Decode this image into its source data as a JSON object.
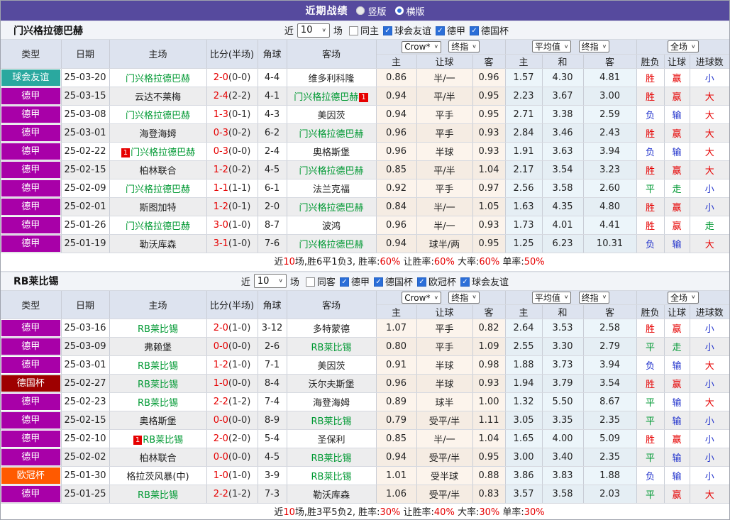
{
  "topbar": {
    "title": "近期战绩",
    "radios": [
      {
        "label": "竖版",
        "selected": false
      },
      {
        "label": "横版",
        "selected": true
      }
    ]
  },
  "filter_labels": {
    "near": "近",
    "games": "场"
  },
  "columns": {
    "type": "类型",
    "date": "日期",
    "home": "主场",
    "score": "比分(半场)",
    "corner": "角球",
    "away": "客场",
    "dropdown_groups": [
      [
        "Crow*",
        "终指"
      ],
      [
        "平均值",
        "终指"
      ],
      [
        "全场"
      ]
    ],
    "sub": [
      "主",
      "让球",
      "客",
      "主",
      "和",
      "客",
      "胜负",
      "让球",
      "进球数"
    ]
  },
  "colors": {
    "topbar_purple": "#564a9e",
    "checkbox_blue": "#2b6ed8",
    "team_green": "#009933",
    "score_red": "#e60000",
    "result_text": {
      "胜": "#e60000",
      "负": "#2233cc",
      "平": "#009933",
      "赢": "#e60000",
      "输": "#2233cc",
      "走": "#009933",
      "大": "#e60000",
      "小": "#2233cc"
    },
    "type_badges": {
      "球会友谊": "#2aa89f",
      "德甲": "#a800a8",
      "德国杯": "#9e0000",
      "欧冠杯": "#ff5a00"
    }
  },
  "sections": [
    {
      "team": "门兴格拉德巴赫",
      "filter": {
        "count": "10",
        "same_label": "同主",
        "same_checked": false,
        "leagues": [
          {
            "label": "球会友谊",
            "checked": true
          },
          {
            "label": "德甲",
            "checked": true
          },
          {
            "label": "德国杯",
            "checked": true
          }
        ]
      },
      "rows": [
        {
          "type": "球会友谊",
          "date": "25-03-20",
          "home": {
            "name": "门兴格拉德巴赫",
            "self": true
          },
          "score": "2-0",
          "half": "(0-0)",
          "corner": "4-4",
          "away": {
            "name": "维多利科隆",
            "self": false
          },
          "odds": [
            "0.86",
            "半/一",
            "0.96",
            "1.57",
            "4.30",
            "4.81"
          ],
          "results": [
            "胜",
            "赢",
            "小"
          ]
        },
        {
          "type": "德甲",
          "date": "25-03-15",
          "home": {
            "name": "云达不莱梅",
            "self": false
          },
          "score": "2-4",
          "half": "(2-2)",
          "corner": "4-1",
          "away": {
            "name": "门兴格拉德巴赫",
            "self": true,
            "badge": "1",
            "badge_pos": "right"
          },
          "odds": [
            "0.94",
            "平/半",
            "0.95",
            "2.23",
            "3.67",
            "3.00"
          ],
          "results": [
            "胜",
            "赢",
            "大"
          ]
        },
        {
          "type": "德甲",
          "date": "25-03-08",
          "home": {
            "name": "门兴格拉德巴赫",
            "self": true
          },
          "score": "1-3",
          "half": "(0-1)",
          "corner": "4-3",
          "away": {
            "name": "美因茨",
            "self": false
          },
          "odds": [
            "0.94",
            "平手",
            "0.95",
            "2.71",
            "3.38",
            "2.59"
          ],
          "results": [
            "负",
            "输",
            "大"
          ]
        },
        {
          "type": "德甲",
          "date": "25-03-01",
          "home": {
            "name": "海登海姆",
            "self": false
          },
          "score": "0-3",
          "half": "(0-2)",
          "corner": "6-2",
          "away": {
            "name": "门兴格拉德巴赫",
            "self": true
          },
          "odds": [
            "0.96",
            "平手",
            "0.93",
            "2.84",
            "3.46",
            "2.43"
          ],
          "results": [
            "胜",
            "赢",
            "大"
          ]
        },
        {
          "type": "德甲",
          "date": "25-02-22",
          "home": {
            "name": "门兴格拉德巴赫",
            "self": true,
            "badge": "1",
            "badge_pos": "left"
          },
          "score": "0-3",
          "half": "(0-0)",
          "corner": "2-4",
          "away": {
            "name": "奥格斯堡",
            "self": false
          },
          "odds": [
            "0.96",
            "半球",
            "0.93",
            "1.91",
            "3.63",
            "3.94"
          ],
          "results": [
            "负",
            "输",
            "大"
          ]
        },
        {
          "type": "德甲",
          "date": "25-02-15",
          "home": {
            "name": "柏林联合",
            "self": false
          },
          "score": "1-2",
          "half": "(0-2)",
          "corner": "4-5",
          "away": {
            "name": "门兴格拉德巴赫",
            "self": true
          },
          "odds": [
            "0.85",
            "平/半",
            "1.04",
            "2.17",
            "3.54",
            "3.23"
          ],
          "results": [
            "胜",
            "赢",
            "大"
          ]
        },
        {
          "type": "德甲",
          "date": "25-02-09",
          "home": {
            "name": "门兴格拉德巴赫",
            "self": true
          },
          "score": "1-1",
          "half": "(1-1)",
          "corner": "6-1",
          "away": {
            "name": "法兰克福",
            "self": false
          },
          "odds": [
            "0.92",
            "平手",
            "0.97",
            "2.56",
            "3.58",
            "2.60"
          ],
          "results": [
            "平",
            "走",
            "小"
          ]
        },
        {
          "type": "德甲",
          "date": "25-02-01",
          "home": {
            "name": "斯图加特",
            "self": false
          },
          "score": "1-2",
          "half": "(0-1)",
          "corner": "2-0",
          "away": {
            "name": "门兴格拉德巴赫",
            "self": true
          },
          "odds": [
            "0.84",
            "半/一",
            "1.05",
            "1.63",
            "4.35",
            "4.80"
          ],
          "results": [
            "胜",
            "赢",
            "小"
          ]
        },
        {
          "type": "德甲",
          "date": "25-01-26",
          "home": {
            "name": "门兴格拉德巴赫",
            "self": true
          },
          "score": "3-0",
          "half": "(1-0)",
          "corner": "8-7",
          "away": {
            "name": "波鸿",
            "self": false
          },
          "odds": [
            "0.96",
            "半/一",
            "0.93",
            "1.73",
            "4.01",
            "4.41"
          ],
          "results": [
            "胜",
            "赢",
            "走"
          ]
        },
        {
          "type": "德甲",
          "date": "25-01-19",
          "home": {
            "name": "勒沃库森",
            "self": false
          },
          "score": "3-1",
          "half": "(1-0)",
          "corner": "7-6",
          "away": {
            "name": "门兴格拉德巴赫",
            "self": true
          },
          "odds": [
            "0.94",
            "球半/两",
            "0.95",
            "1.25",
            "6.23",
            "10.31"
          ],
          "results": [
            "负",
            "输",
            "大"
          ]
        }
      ],
      "summary": [
        [
          "近",
          "k"
        ],
        [
          "10",
          "r"
        ],
        [
          "场,胜6平1负3, 胜率:",
          "k"
        ],
        [
          "60%",
          "r"
        ],
        [
          " 让胜率:",
          "k"
        ],
        [
          "60%",
          "r"
        ],
        [
          " 大率:",
          "k"
        ],
        [
          "60%",
          "r"
        ],
        [
          " 单率:",
          "k"
        ],
        [
          "50%",
          "r"
        ]
      ]
    },
    {
      "team": "RB莱比锡",
      "filter": {
        "count": "10",
        "same_label": "同客",
        "same_checked": false,
        "leagues": [
          {
            "label": "德甲",
            "checked": true
          },
          {
            "label": "德国杯",
            "checked": true
          },
          {
            "label": "欧冠杯",
            "checked": true
          },
          {
            "label": "球会友谊",
            "checked": true
          }
        ]
      },
      "rows": [
        {
          "type": "德甲",
          "date": "25-03-16",
          "home": {
            "name": "RB莱比锡",
            "self": true
          },
          "score": "2-0",
          "half": "(1-0)",
          "corner": "3-12",
          "away": {
            "name": "多特蒙德",
            "self": false
          },
          "odds": [
            "1.07",
            "平手",
            "0.82",
            "2.64",
            "3.53",
            "2.58"
          ],
          "results": [
            "胜",
            "赢",
            "小"
          ]
        },
        {
          "type": "德甲",
          "date": "25-03-09",
          "home": {
            "name": "弗赖堡",
            "self": false
          },
          "score": "0-0",
          "half": "(0-0)",
          "corner": "2-6",
          "away": {
            "name": "RB莱比锡",
            "self": true
          },
          "odds": [
            "0.80",
            "平手",
            "1.09",
            "2.55",
            "3.30",
            "2.79"
          ],
          "results": [
            "平",
            "走",
            "小"
          ]
        },
        {
          "type": "德甲",
          "date": "25-03-01",
          "home": {
            "name": "RB莱比锡",
            "self": true
          },
          "score": "1-2",
          "half": "(1-0)",
          "corner": "7-1",
          "away": {
            "name": "美因茨",
            "self": false
          },
          "odds": [
            "0.91",
            "半球",
            "0.98",
            "1.88",
            "3.73",
            "3.94"
          ],
          "results": [
            "负",
            "输",
            "大"
          ]
        },
        {
          "type": "德国杯",
          "date": "25-02-27",
          "home": {
            "name": "RB莱比锡",
            "self": true
          },
          "score": "1-0",
          "half": "(0-0)",
          "corner": "8-4",
          "away": {
            "name": "沃尔夫斯堡",
            "self": false
          },
          "odds": [
            "0.96",
            "半球",
            "0.93",
            "1.94",
            "3.79",
            "3.54"
          ],
          "results": [
            "胜",
            "赢",
            "小"
          ]
        },
        {
          "type": "德甲",
          "date": "25-02-23",
          "home": {
            "name": "RB莱比锡",
            "self": true
          },
          "score": "2-2",
          "half": "(1-2)",
          "corner": "7-4",
          "away": {
            "name": "海登海姆",
            "self": false
          },
          "odds": [
            "0.89",
            "球半",
            "1.00",
            "1.32",
            "5.50",
            "8.67"
          ],
          "results": [
            "平",
            "输",
            "大"
          ]
        },
        {
          "type": "德甲",
          "date": "25-02-15",
          "home": {
            "name": "奥格斯堡",
            "self": false
          },
          "score": "0-0",
          "half": "(0-0)",
          "corner": "8-9",
          "away": {
            "name": "RB莱比锡",
            "self": true
          },
          "odds": [
            "0.79",
            "受平/半",
            "1.11",
            "3.05",
            "3.35",
            "2.35"
          ],
          "results": [
            "平",
            "输",
            "小"
          ]
        },
        {
          "type": "德甲",
          "date": "25-02-10",
          "home": {
            "name": "RB莱比锡",
            "self": true,
            "badge": "1",
            "badge_pos": "left"
          },
          "score": "2-0",
          "half": "(2-0)",
          "corner": "5-4",
          "away": {
            "name": "圣保利",
            "self": false
          },
          "odds": [
            "0.85",
            "半/一",
            "1.04",
            "1.65",
            "4.00",
            "5.09"
          ],
          "results": [
            "胜",
            "赢",
            "小"
          ]
        },
        {
          "type": "德甲",
          "date": "25-02-02",
          "home": {
            "name": "柏林联合",
            "self": false
          },
          "score": "0-0",
          "half": "(0-0)",
          "corner": "4-5",
          "away": {
            "name": "RB莱比锡",
            "self": true
          },
          "odds": [
            "0.94",
            "受平/半",
            "0.95",
            "3.00",
            "3.40",
            "2.35"
          ],
          "results": [
            "平",
            "输",
            "小"
          ]
        },
        {
          "type": "欧冠杯",
          "date": "25-01-30",
          "home": {
            "name": "格拉茨风暴(中)",
            "self": false
          },
          "score": "1-0",
          "half": "(1-0)",
          "corner": "3-9",
          "away": {
            "name": "RB莱比锡",
            "self": true
          },
          "odds": [
            "1.01",
            "受半球",
            "0.88",
            "3.86",
            "3.83",
            "1.88"
          ],
          "results": [
            "负",
            "输",
            "小"
          ]
        },
        {
          "type": "德甲",
          "date": "25-01-25",
          "home": {
            "name": "RB莱比锡",
            "self": true
          },
          "score": "2-2",
          "half": "(1-2)",
          "corner": "7-3",
          "away": {
            "name": "勒沃库森",
            "self": false
          },
          "odds": [
            "1.06",
            "受平/半",
            "0.83",
            "3.57",
            "3.58",
            "2.03"
          ],
          "results": [
            "平",
            "赢",
            "大"
          ]
        }
      ],
      "summary": [
        [
          "近",
          "k"
        ],
        [
          "10",
          "r"
        ],
        [
          "场,胜3平5负2, 胜率:",
          "k"
        ],
        [
          "30%",
          "r"
        ],
        [
          " 让胜率:",
          "k"
        ],
        [
          "40%",
          "r"
        ],
        [
          " 大率:",
          "k"
        ],
        [
          "30%",
          "r"
        ],
        [
          " 单率:",
          "k"
        ],
        [
          "30%",
          "r"
        ]
      ]
    }
  ]
}
